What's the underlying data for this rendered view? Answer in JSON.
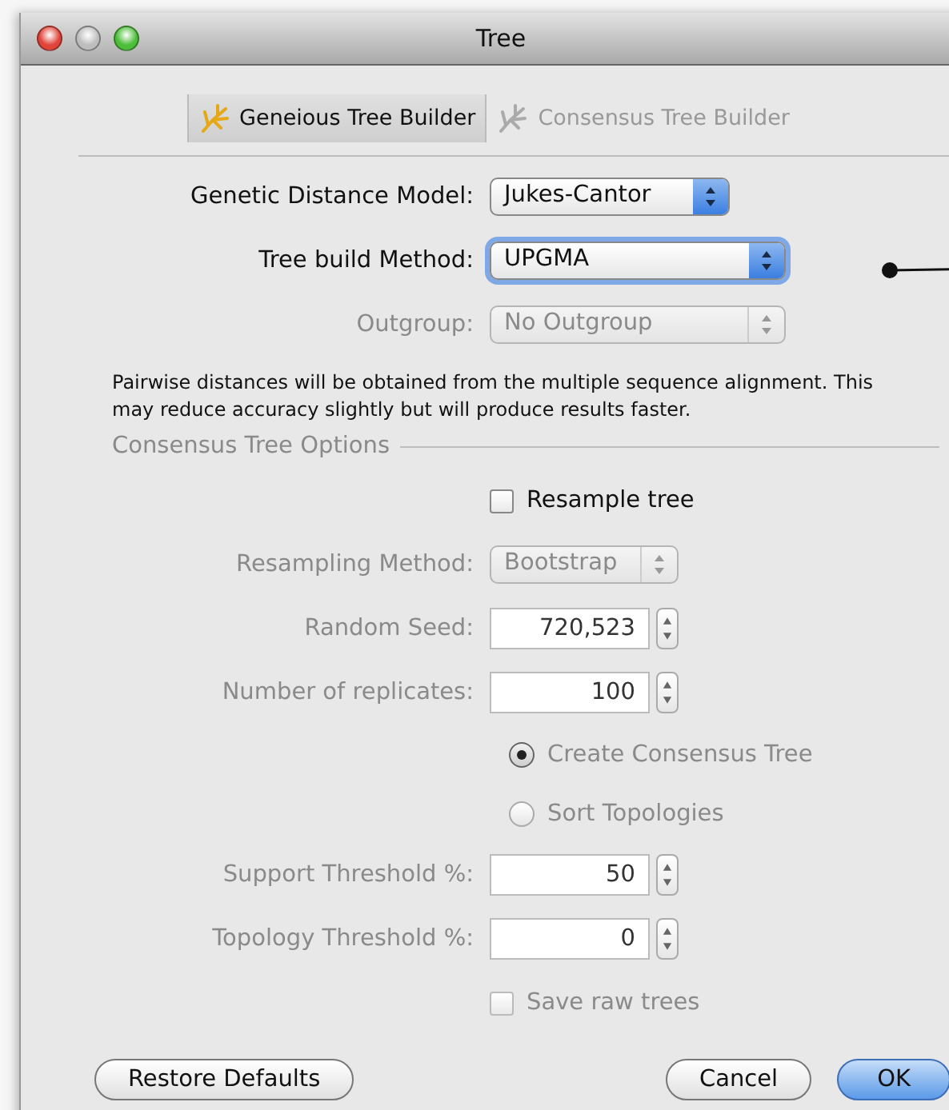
{
  "window": {
    "title": "Tree"
  },
  "tabs": [
    {
      "label": "Geneious Tree Builder",
      "selected": true
    },
    {
      "label": "Consensus Tree Builder",
      "selected": false
    }
  ],
  "settings": [
    {
      "kind": "popup",
      "label": "Genetic Distance Model:",
      "value": "Jukes-Cantor",
      "disabled": false,
      "focused": false
    },
    {
      "kind": "popup",
      "label": "Tree build Method:",
      "value": "UPGMA",
      "disabled": false,
      "focused": true
    },
    {
      "kind": "popup",
      "label": "Outgroup:",
      "value": "No Outgroup",
      "disabled": true,
      "focused": false
    }
  ],
  "note": "Pairwise distances will be obtained from the multiple sequence alignment. This may reduce accuracy slightly but will produce results faster.",
  "consensus_options": {
    "title": "Consensus Tree Options",
    "items": [
      {
        "kind": "checkbox",
        "label": "Resample tree",
        "checked": false,
        "disabled": false
      },
      {
        "kind": "popup",
        "label": "Resampling Method:",
        "value": "Bootstrap",
        "disabled": true
      },
      {
        "kind": "stepper",
        "label": "Random Seed:",
        "value": "720,523",
        "disabled": true
      },
      {
        "kind": "stepper",
        "label": "Number of replicates:",
        "value": "100",
        "disabled": true
      },
      {
        "kind": "radio",
        "label": "Create Consensus Tree",
        "selected": true,
        "disabled": true
      },
      {
        "kind": "radio",
        "label": "Sort Topologies",
        "selected": false,
        "disabled": true
      },
      {
        "kind": "stepper",
        "label": "Support Threshold %:",
        "value": "50",
        "disabled": true
      },
      {
        "kind": "stepper",
        "label": "Topology Threshold %:",
        "value": "0",
        "disabled": true
      },
      {
        "kind": "checkbox",
        "label": "Save raw trees",
        "checked": false,
        "disabled": true
      }
    ]
  },
  "buttons": [
    {
      "label": "Restore Defaults",
      "default": false
    },
    {
      "label": "Cancel",
      "default": false
    },
    {
      "label": "OK",
      "default": true
    }
  ]
}
